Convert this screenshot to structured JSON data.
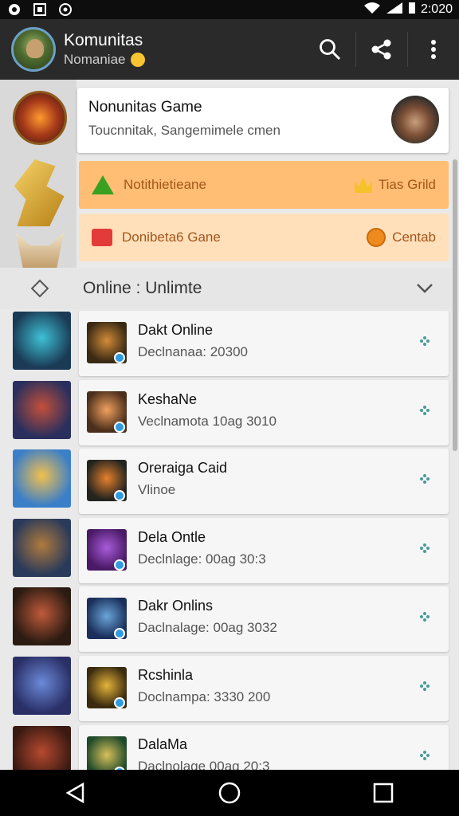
{
  "status_bar": {
    "time": "2:020"
  },
  "app_bar": {
    "title": "Komunitas",
    "subtitle": "Nomaniae"
  },
  "feature_card": {
    "title": "Nonunitas Game",
    "subtitle": "Toucnnitak, Sangemimele cmen"
  },
  "notices": [
    {
      "label": "Notithietieane",
      "right_label": "Tias Grild",
      "color": "#ffbe74"
    },
    {
      "label": "Donibeta6 Gane",
      "right_label": "Centab",
      "color": "#ffe0bb"
    }
  ],
  "section": {
    "title": "Online :  Unlimte"
  },
  "list": [
    {
      "name": "Dakt Online",
      "meta": "Declnanaa: 20300",
      "thumb": [
        "#1a3a55",
        "#3ec1d6"
      ],
      "mini": [
        "#3a2a14",
        "#d38b38"
      ]
    },
    {
      "name": "KeshaNe",
      "meta": "Veclnamota 10ag 3010",
      "thumb": [
        "#2a2f5d",
        "#c44f3a"
      ],
      "mini": [
        "#4b2e1b",
        "#f0a15e"
      ]
    },
    {
      "name": "Oreraiga Caid",
      "meta": "Vlinoe",
      "thumb": [
        "#3b7fc9",
        "#f2c04d"
      ],
      "mini": [
        "#24241f",
        "#e6802c"
      ]
    },
    {
      "name": "Dela Ontle",
      "meta": "Declnlage: 00ag 30:3",
      "thumb": [
        "#2a3a5a",
        "#b07a3c"
      ],
      "mini": [
        "#4a1a66",
        "#a95bd9"
      ]
    },
    {
      "name": "Dakr Onlins",
      "meta": "Daclnalage: 00ag 3032",
      "thumb": [
        "#2b1b12",
        "#c05a3a"
      ],
      "mini": [
        "#1a2f5a",
        "#6aa5d9"
      ]
    },
    {
      "name": "Rcshinla",
      "meta": "Doclnampa: 3330 200",
      "thumb": [
        "#2a2f66",
        "#6b8ad9"
      ],
      "mini": [
        "#3a2a0f",
        "#e5b33a"
      ]
    },
    {
      "name": "DalaMa",
      "meta": "Daclnolage 00ag 20:3",
      "thumb": [
        "#3a1a12",
        "#b6492f"
      ],
      "mini": [
        "#1f4a2a",
        "#d8c15a"
      ]
    }
  ]
}
